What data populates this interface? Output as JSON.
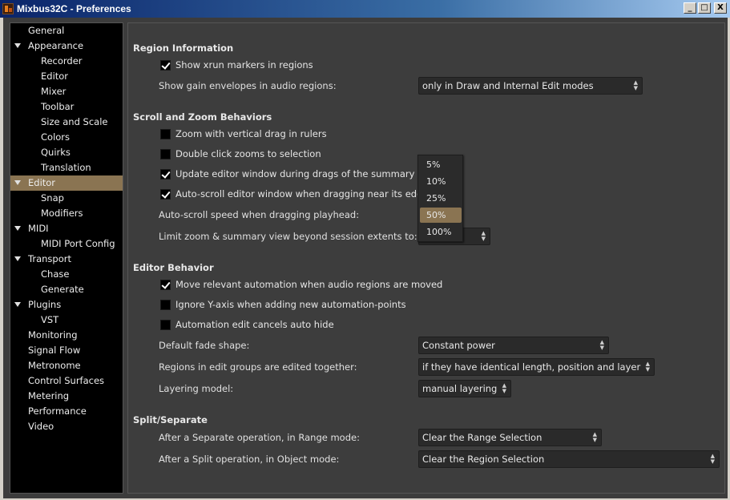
{
  "window": {
    "title": "Mixbus32C - Preferences",
    "controls": {
      "minimize": "_",
      "maximize": "□",
      "close": "X"
    }
  },
  "sidebar": {
    "items": [
      {
        "label": "General",
        "level": 0
      },
      {
        "label": "Appearance",
        "level": 0,
        "expanded": true
      },
      {
        "label": "Recorder",
        "level": 1
      },
      {
        "label": "Editor",
        "level": 1
      },
      {
        "label": "Mixer",
        "level": 1
      },
      {
        "label": "Toolbar",
        "level": 1
      },
      {
        "label": "Size and Scale",
        "level": 1
      },
      {
        "label": "Colors",
        "level": 1
      },
      {
        "label": "Quirks",
        "level": 1
      },
      {
        "label": "Translation",
        "level": 1
      },
      {
        "label": "Editor",
        "level": 0,
        "expanded": true,
        "selected": true
      },
      {
        "label": "Snap",
        "level": 1
      },
      {
        "label": "Modifiers",
        "level": 1
      },
      {
        "label": "MIDI",
        "level": 0,
        "expanded": true
      },
      {
        "label": "MIDI Port Config",
        "level": 1
      },
      {
        "label": "Transport",
        "level": 0,
        "expanded": true
      },
      {
        "label": "Chase",
        "level": 1
      },
      {
        "label": "Generate",
        "level": 1
      },
      {
        "label": "Plugins",
        "level": 0,
        "expanded": true
      },
      {
        "label": "VST",
        "level": 1
      },
      {
        "label": "Monitoring",
        "level": 0
      },
      {
        "label": "Signal Flow",
        "level": 0
      },
      {
        "label": "Metronome",
        "level": 0
      },
      {
        "label": "Control Surfaces",
        "level": 0
      },
      {
        "label": "Metering",
        "level": 0
      },
      {
        "label": "Performance",
        "level": 0
      },
      {
        "label": "Video",
        "level": 0
      }
    ]
  },
  "region_information": {
    "title": "Region Information",
    "show_xrun": {
      "label": "Show xrun markers in regions",
      "checked": true
    },
    "gain_envelopes": {
      "label": "Show gain envelopes in audio regions:",
      "value": "only in Draw and Internal Edit modes"
    }
  },
  "scroll_zoom": {
    "title": "Scroll and Zoom Behaviors",
    "zoom_vertical_drag": {
      "label": "Zoom with vertical drag in rulers",
      "checked": false
    },
    "double_click_zoom": {
      "label": "Double click zooms to selection",
      "checked": false
    },
    "update_editor": {
      "label": "Update editor window during drags of the summary",
      "checked": true
    },
    "auto_scroll": {
      "label": "Auto-scroll editor window when dragging near its edg",
      "checked": true
    },
    "auto_scroll_speed": {
      "label": "Auto-scroll speed when dragging playhead:"
    },
    "limit_zoom": {
      "label": "Limit zoom & summary view beyond session extents to:"
    }
  },
  "speed_popup": {
    "options": [
      "5%",
      "10%",
      "25%",
      "50%",
      "100%"
    ],
    "active": "50%"
  },
  "editor_behavior": {
    "title": "Editor Behavior",
    "move_automation": {
      "label": "Move relevant automation when audio regions are moved",
      "checked": true
    },
    "ignore_y_axis": {
      "label": "Ignore Y-axis when adding new automation-points",
      "checked": false
    },
    "automation_edit_hide": {
      "label": "Automation edit cancels auto hide",
      "checked": false
    },
    "default_fade": {
      "label": "Default fade shape:",
      "value": "Constant power"
    },
    "edit_groups": {
      "label": "Regions in edit groups are edited together:",
      "value": "if they have identical length, position and layer"
    },
    "layering": {
      "label": "Layering model:",
      "value": "manual layering"
    }
  },
  "split_separate": {
    "title": "Split/Separate",
    "separate_range": {
      "label": "After a Separate operation, in Range mode:",
      "value": "Clear the Range Selection"
    },
    "split_object": {
      "label": "After a Split operation, in Object mode:",
      "value": "Clear the Region Selection"
    }
  },
  "colors": {
    "selection": "#8a7452",
    "panel": "#3d3d3d",
    "sidebar": "#000000"
  }
}
